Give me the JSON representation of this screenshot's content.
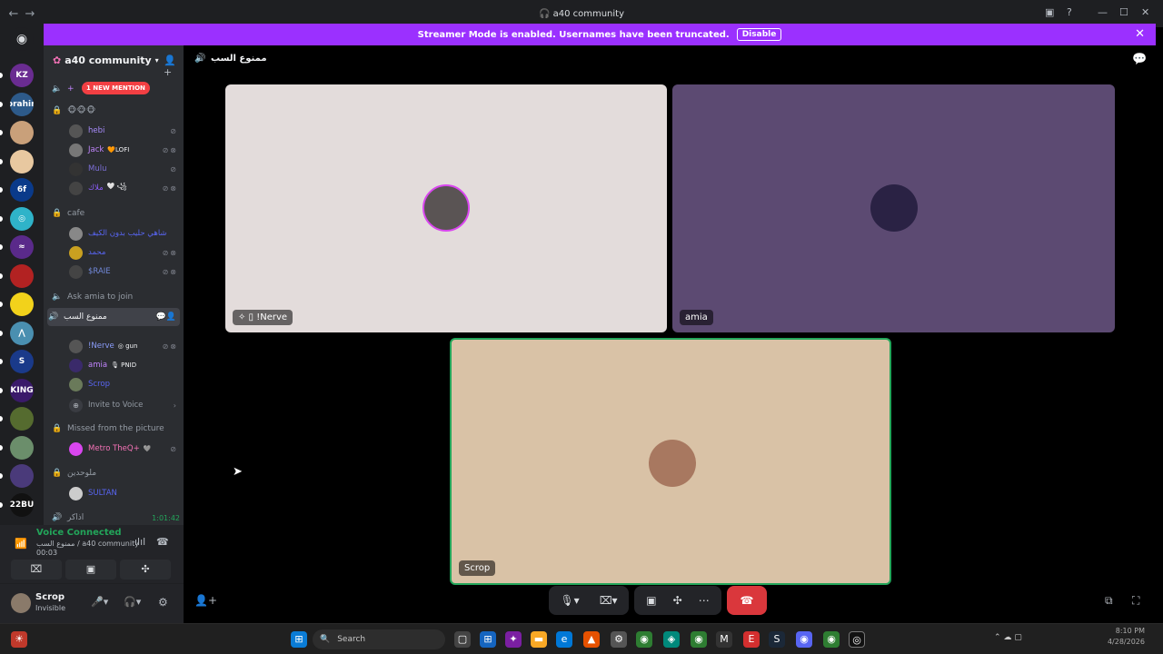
{
  "window": {
    "title": "a40 community",
    "back": "←",
    "forward": "→",
    "min": "—",
    "max": "☐",
    "close": "✕"
  },
  "banner": {
    "text": "Streamer Mode is enabled. Usernames have been truncated.",
    "disable_label": "Disable",
    "close": "✕"
  },
  "servers": [
    {
      "label": "KZ",
      "color": "#6a2c91"
    },
    {
      "label": "ibrahim",
      "color": "#2d5a8a"
    },
    {
      "label": "",
      "color": "#c9a07a"
    },
    {
      "label": "",
      "color": "#e8c8a0"
    },
    {
      "label": "6f",
      "color": "#0a3a8a"
    },
    {
      "label": "◎",
      "color": "#2fb3c9"
    },
    {
      "label": "≈",
      "color": "#5a2a8a"
    },
    {
      "label": "",
      "color": "#b22222"
    },
    {
      "label": "",
      "color": "#f2d21b"
    },
    {
      "label": "⋀",
      "color": "#4a8fb0"
    },
    {
      "label": "S",
      "color": "#1a3a8a"
    },
    {
      "label": "KING",
      "color": "#3a1a6a"
    },
    {
      "label": "",
      "color": "#556b2f"
    },
    {
      "label": "",
      "color": "#6b8e6b"
    },
    {
      "label": "",
      "color": "#4a3a7a"
    },
    {
      "label": "22BU",
      "color": "#111"
    }
  ],
  "sidebar": {
    "server_name": "a40 community",
    "mention_badge": "1 NEW MENTION",
    "emoji_channel": "🐵🐵🐵",
    "channels": {
      "cafe": "cafe",
      "ask": "Ask amia to join",
      "active": "ممنوع السب",
      "missed": "Missed from the picture",
      "lonely": "ملوحدين",
      "last": "اذاكر"
    },
    "users_emoji": [
      {
        "name": "hebi",
        "color": "#a78bfa"
      },
      {
        "name": "Jack",
        "tag": "🧡LOFI",
        "color": "#c084fc"
      },
      {
        "name": "Mulu",
        "color": "#7c6fd6"
      },
      {
        "name": "ملاك",
        "tag": "🤍 ꧁ ",
        "color": "#8b5cf6"
      }
    ],
    "users_cafe": [
      {
        "name": "شاهي حليب بدون الكيف",
        "color": "#5865f2"
      },
      {
        "name": "محمد",
        "color": "#5865f2"
      },
      {
        "name": "$RAIE",
        "color": "#7289da"
      }
    ],
    "users_active": [
      {
        "name": "!Nerve",
        "tag": "◎ gun",
        "color": "#8b9dfb"
      },
      {
        "name": "amia",
        "tag": "🎙 PNID",
        "color": "#c084fc"
      },
      {
        "name": "Scrop",
        "color": "#5865f2"
      }
    ],
    "invite": "Invite to Voice",
    "users_missed": [
      {
        "name": "Metro TheQ+",
        "tag": "🩶",
        "color": "#f472b6"
      }
    ],
    "users_lonely": [
      {
        "name": "SULTAN",
        "color": "#5865f2"
      }
    ],
    "timer": "1:01:42"
  },
  "voice": {
    "status": "Voice Connected",
    "location": "ممنوع السب / a40 community",
    "elapsed": "00:03"
  },
  "userpanel": {
    "name": "Scrop",
    "status": "Invisible"
  },
  "main": {
    "channel_title": "ممنوع السب",
    "tiles": [
      {
        "name": "!Nerve",
        "bg": "#e3dcdb"
      },
      {
        "name": "amia",
        "bg": "#5c4a72"
      },
      {
        "name": "Scrop",
        "bg": "#d9c2a6"
      }
    ]
  },
  "taskbar": {
    "search_placeholder": "Search",
    "time": "8:10 PM",
    "date": "4/28/2026"
  }
}
